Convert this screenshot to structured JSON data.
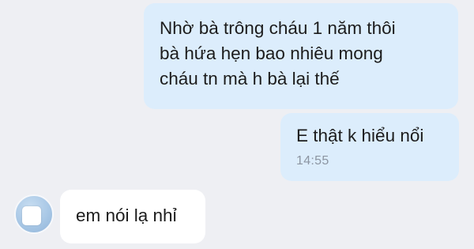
{
  "chat": {
    "messages": [
      {
        "direction": "outgoing",
        "lines": [
          "Nhờ bà trông cháu 1 năm thôi",
          "bà hứa hẹn bao nhiêu mong",
          "cháu tn mà h bà lại thế"
        ]
      },
      {
        "direction": "outgoing",
        "text": "E thật k hiểu nổi",
        "time": "14:55"
      },
      {
        "direction": "incoming",
        "text": "em nói lạ nhỉ"
      }
    ]
  },
  "colors": {
    "background": "#eeeff3",
    "outgoing_bubble": "#dcedfc",
    "incoming_bubble": "#ffffff",
    "timestamp": "#8c95a2"
  },
  "icons": {
    "avatar": "contact-avatar-icon"
  }
}
